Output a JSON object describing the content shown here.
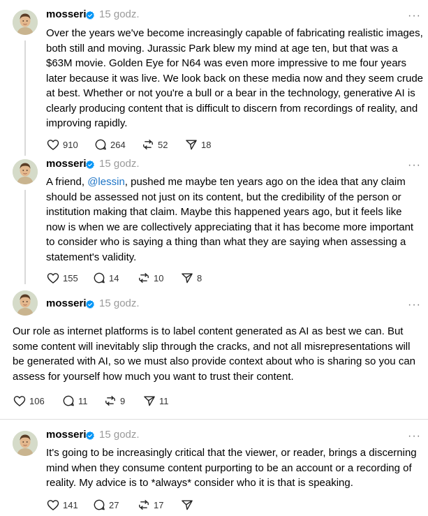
{
  "posts": [
    {
      "author": "mosseri",
      "time": "15 godz.",
      "text": "Over the years we've become increasingly capable of fabricating realistic images, both still and moving. Jurassic Park blew my mind at age ten, but that was a $63M movie. Golden Eye for N64 was even more impressive to me four years later because it was live. We look back on these media now and they seem crude at best. Whether or not you're a bull or a bear in the technology, generative AI is clearly producing content that is difficult to discern from recordings of reality, and improving rapidly.",
      "likes": "910",
      "replies": "264",
      "reposts": "52",
      "shares": "18"
    },
    {
      "author": "mosseri",
      "time": "15 godz.",
      "text_before": "A friend, ",
      "mention": "@lessin",
      "text_after": ", pushed me maybe ten years ago on the idea that any claim should be assessed not just on its content, but the credibility of the person or institution making that claim. Maybe this happened years ago, but it feels like now is when we are collectively appreciating that it has become more important to consider who is saying a thing than what they are saying when assessing a statement's validity.",
      "likes": "155",
      "replies": "14",
      "reposts": "10",
      "shares": "8"
    },
    {
      "author": "mosseri",
      "time": "15 godz.",
      "text": "Our role as internet platforms is to label content generated as AI as best we can. But some content will inevitably slip through the cracks, and not all misrepresentations will be generated with AI, so we must also provide context about who is sharing so you can assess for yourself how much you want to trust their content.",
      "likes": "106",
      "replies": "11",
      "reposts": "9",
      "shares": "11"
    },
    {
      "author": "mosseri",
      "time": "15 godz.",
      "text": "It's going to be increasingly critical that the viewer, or reader, brings a discerning mind when they consume content purporting to be an account or a recording of reality. My advice is to *always* consider who it is that is speaking.",
      "likes": "141",
      "replies": "27",
      "reposts": "17",
      "shares": ""
    }
  ],
  "icons": {
    "like": "heart-icon",
    "reply": "comment-icon",
    "repost": "repost-icon",
    "share": "send-icon",
    "verified": "verified-badge-icon",
    "more": "more-options-icon"
  },
  "colors": {
    "mention": "#1d74c6",
    "verified": "#0095f6",
    "muted": "#9a9a9a"
  }
}
